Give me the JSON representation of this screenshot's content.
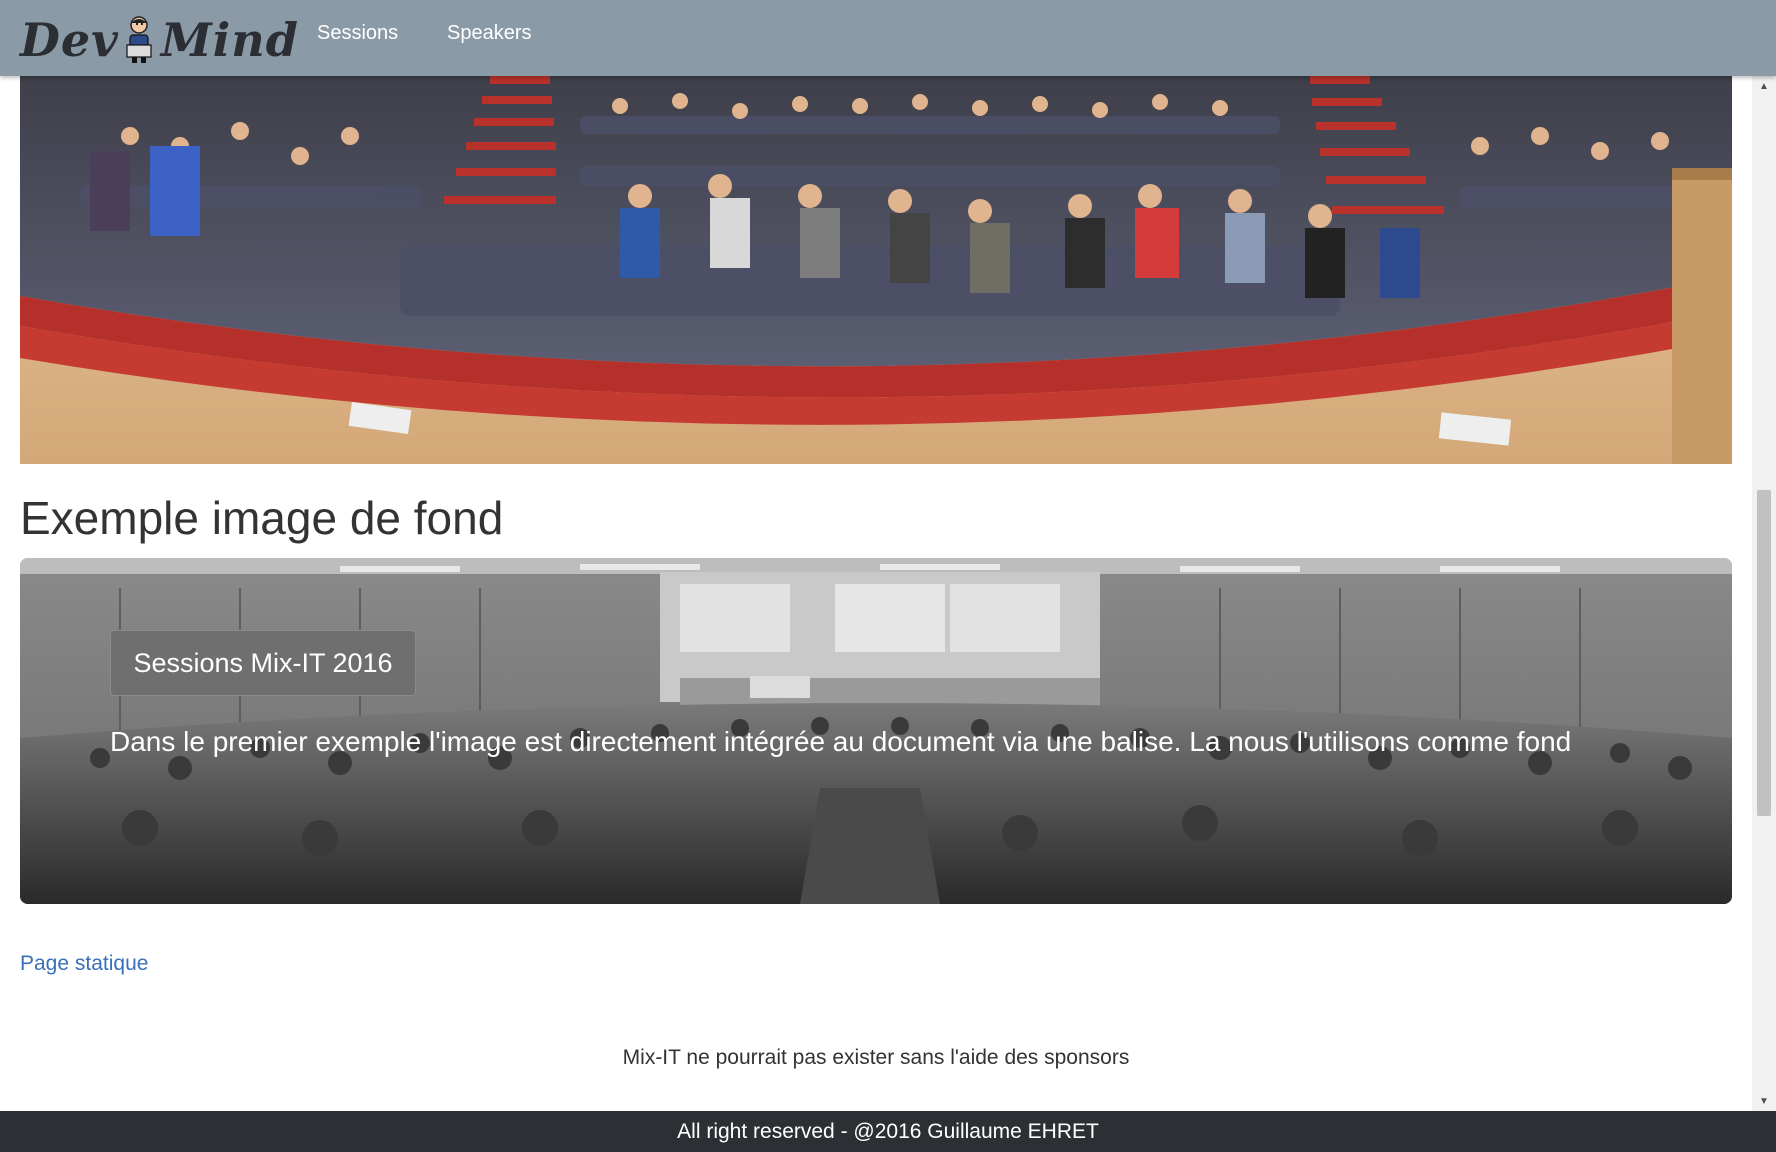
{
  "navbar": {
    "brand_left": "Dev",
    "brand_right": "Mind",
    "links": [
      "Sessions",
      "Speakers"
    ]
  },
  "main": {
    "section_title": "Exemple image de fond",
    "banner": {
      "button_label": "Sessions Mix-IT 2016",
      "text": "Dans le premier exemple l'image est directement intégrée au document via une balise. La nous l'utilisons comme fond"
    },
    "static_link": "Page statique",
    "sponsor_text": "Mix-IT ne pourrait pas exister sans l'aide des sponsors"
  },
  "footer": {
    "text": "All right reserved - @2016 Guillaume EHRET"
  },
  "colors": {
    "navbar_bg": "#8a9aa6",
    "link": "#3a70b8",
    "footer_bg": "#2c2f33",
    "carpet": "#b5302a",
    "seat": "#4b4f66"
  }
}
